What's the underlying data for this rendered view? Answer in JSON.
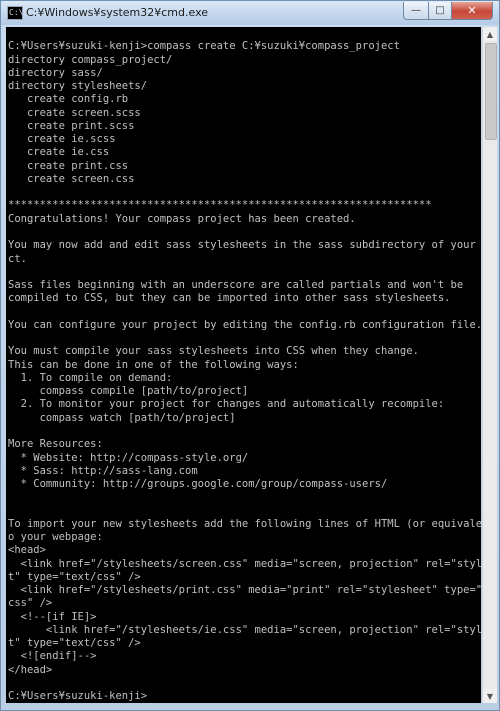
{
  "window": {
    "title": "C:¥Windows¥system32¥cmd.exe",
    "icon_text": "C:\\",
    "controls": {
      "minimize": "—",
      "maximize": "□",
      "close": "✕"
    }
  },
  "console": {
    "lines": [
      "",
      "C:¥Users¥suzuki-kenji>compass create C:¥suzuki¥compass_project",
      "directory compass_project/",
      "directory sass/",
      "directory stylesheets/",
      "   create config.rb",
      "   create screen.scss",
      "   create print.scss",
      "   create ie.scss",
      "   create ie.css",
      "   create print.css",
      "   create screen.css",
      "",
      "*******************************************************************",
      "Congratulations! Your compass project has been created.",
      "",
      "You may now add and edit sass stylesheets in the sass subdirectory of your proje",
      "ct.",
      "",
      "Sass files beginning with an underscore are called partials and won't be",
      "compiled to CSS, but they can be imported into other sass stylesheets.",
      "",
      "You can configure your project by editing the config.rb configuration file.",
      "",
      "You must compile your sass stylesheets into CSS when they change.",
      "This can be done in one of the following ways:",
      "  1. To compile on demand:",
      "     compass compile [path/to/project]",
      "  2. To monitor your project for changes and automatically recompile:",
      "     compass watch [path/to/project]",
      "",
      "More Resources:",
      "  * Website: http://compass-style.org/",
      "  * Sass: http://sass-lang.com",
      "  * Community: http://groups.google.com/group/compass-users/",
      "",
      "",
      "To import your new stylesheets add the following lines of HTML (or equivalent) t",
      "o your webpage:",
      "<head>",
      "  <link href=\"/stylesheets/screen.css\" media=\"screen, projection\" rel=\"styleshee",
      "t\" type=\"text/css\" />",
      "  <link href=\"/stylesheets/print.css\" media=\"print\" rel=\"stylesheet\" type=\"text/",
      "css\" />",
      "  <!--[if IE]>",
      "      <link href=\"/stylesheets/ie.css\" media=\"screen, projection\" rel=\"styleshee",
      "t\" type=\"text/css\" />",
      "  <![endif]-->",
      "</head>",
      "",
      "C:¥Users¥suzuki-kenji>"
    ]
  },
  "scrollbar": {
    "up_arrow": "▲",
    "down_arrow": "▼"
  },
  "colors": {
    "console_bg": "#000000",
    "console_fg": "#c0c0c0",
    "frame": "#b9cde3"
  }
}
